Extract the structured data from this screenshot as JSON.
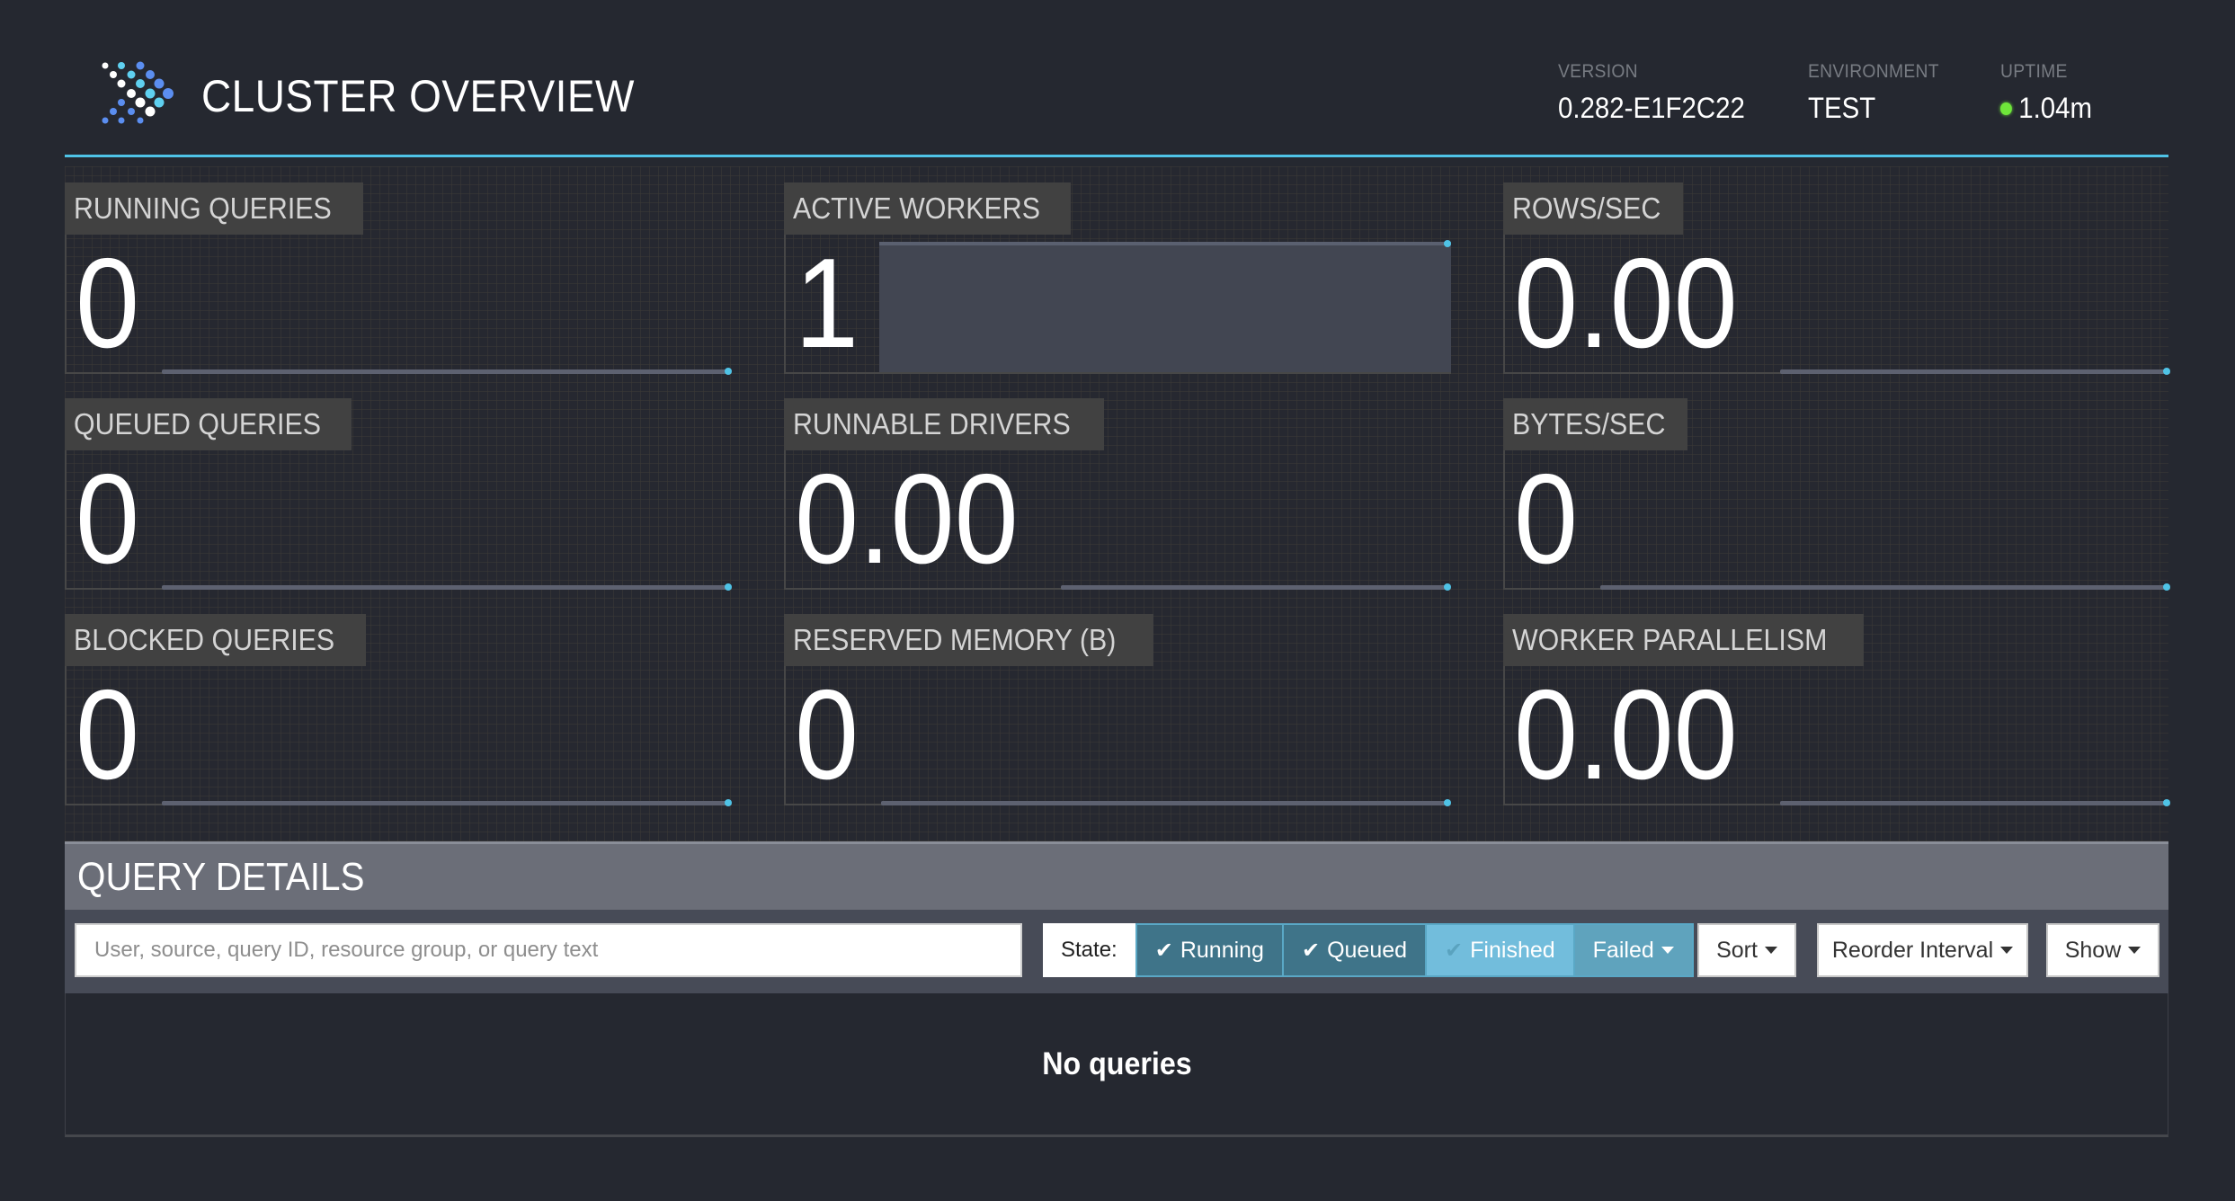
{
  "header": {
    "title": "CLUSTER OVERVIEW",
    "logo_icon": "presto-dots-logo",
    "version": {
      "label": "VERSION",
      "value": "0.282-E1F2C22"
    },
    "environment": {
      "label": "ENVIRONMENT",
      "value": "TEST"
    },
    "uptime": {
      "label": "UPTIME",
      "value": "1.04m",
      "status_color": "#6fe63a"
    }
  },
  "colors": {
    "accent": "#4fc3e6",
    "background": "#252830",
    "label_box": "#414141",
    "section_header": "#6b6e78",
    "toolbar": "#474b57",
    "state_on": "#3f7489",
    "state_off": "#72bddc"
  },
  "stats": [
    {
      "label": "RUNNING QUERIES",
      "value": "0"
    },
    {
      "label": "ACTIVE WORKERS",
      "value": "1"
    },
    {
      "label": "ROWS/SEC",
      "value": "0.00"
    },
    {
      "label": "QUEUED QUERIES",
      "value": "0"
    },
    {
      "label": "RUNNABLE DRIVERS",
      "value": "0.00"
    },
    {
      "label": "BYTES/SEC",
      "value": "0"
    },
    {
      "label": "BLOCKED QUERIES",
      "value": "0"
    },
    {
      "label": "RESERVED MEMORY (B)",
      "value": "0"
    },
    {
      "label": "WORKER PARALLELISM",
      "value": "0.00"
    }
  ],
  "query_details": {
    "title": "QUERY DETAILS",
    "search_placeholder": "User, source, query ID, resource group, or query text",
    "search_value": "",
    "state_label": "State:",
    "state_filters": [
      {
        "label": "Running",
        "checked": true
      },
      {
        "label": "Queued",
        "checked": true
      },
      {
        "label": "Finished",
        "checked": false
      },
      {
        "label": "Failed",
        "dropdown": true
      }
    ],
    "check_glyph": "✔",
    "sort_label": "Sort",
    "reorder_label": "Reorder Interval",
    "show_label": "Show",
    "empty_message": "No queries"
  }
}
